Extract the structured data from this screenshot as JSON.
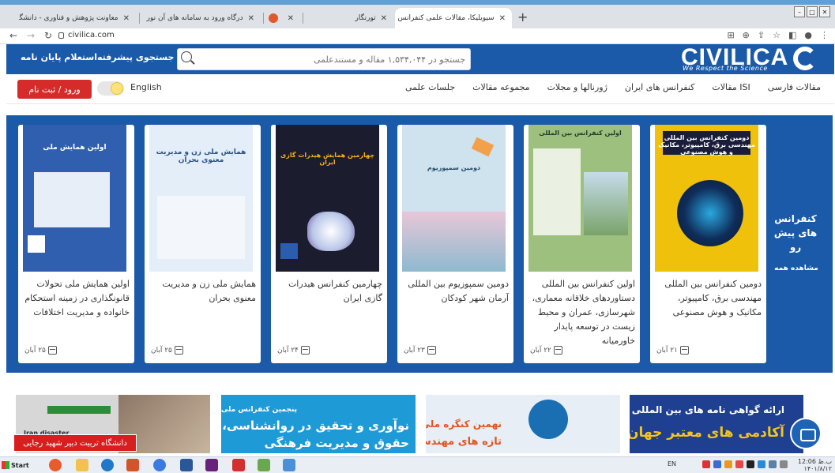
{
  "browser": {
    "tabs": [
      {
        "title": "معاونت پژوهش و فناوری - دانشگا",
        "active": false
      },
      {
        "title": "درگاه ورود به سامانه های آن نور",
        "active": false
      },
      {
        "title": "",
        "active": false
      },
      {
        "title": "تورنگار",
        "active": false
      },
      {
        "title": "سیویلیکا، مقالات علمی کنفرانس و",
        "active": true
      }
    ],
    "url": "civilica.com"
  },
  "site": {
    "logo_text": "CIVILICA",
    "tagline": "We Respect the Science",
    "search_placeholder": "جستجو در ۱,۵۳۴,۰۴۴ مقاله و مستندعلمی",
    "advanced_search": "جستجوی پیشرفته",
    "thesis_inquiry": "استعلام پایان نامه",
    "nav": [
      "مقالات فارسی",
      "مقالات ISI",
      "کنفرانس های ایران",
      "ژورنالها و مجلات",
      "مجموعه مقالات",
      "جلسات علمی"
    ],
    "login": "ورود / ثبت نام",
    "language": "English"
  },
  "conferences": {
    "heading": "کنفرانس های پیش رو",
    "see_all": "مشاهده همه",
    "cards": [
      {
        "title": "دومین کنفرانس بین المللی مهندسی برق، کامپیوتر، مکانیک و هوش مصنوعی",
        "date": "۲۱ آبان",
        "poster_color": "#f0c10a",
        "poster_text": "دومین کنفرانس بین المللی مهندسی برق، کامپیوتر، مکانیک و هوش مصنوعی"
      },
      {
        "title": "اولین کنفرانس بین المللی دستاوردهای خلاقانه معماری، شهرسازی، عمران و محیط زیست در توسعه پایدار خاورمیانه",
        "date": "۲۲ آبان",
        "poster_color": "#9dc07e",
        "poster_text": "اولین کنفرانس بین المللی"
      },
      {
        "title": "دومین سمپوزیوم بین المللی آرمان شهر کودکان",
        "date": "۲۳ آبان",
        "poster_color": "#cfe3ef",
        "poster_text": "دومین سمپوزیوم"
      },
      {
        "title": "چهارمین کنفرانس هیدرات گازی ایران",
        "date": "۲۴ آبان",
        "poster_color": "#1b1d2e",
        "poster_text": "چهارمین همایش هیدرات گازی ایران"
      },
      {
        "title": "همایش ملی زن و مدیریت معنوی بحران",
        "date": "۲۵ آبان",
        "poster_color": "#e3eef8",
        "poster_text": "همایش ملی زن و مدیریت معنوی بحران"
      },
      {
        "title": "اولین همایش ملی تحولات قانونگذاری در زمینه استحکام خانواده و مدیریت اختلافات",
        "date": "۲۵ آبان",
        "poster_color": "#2f5fae",
        "poster_text": "اولین همایش ملی"
      }
    ]
  },
  "ads": [
    {
      "text": "ارائه گواهی نامه های بین المللی",
      "text2": "آکادمی های معتبر جهان",
      "bg": "#1f3f91"
    },
    {
      "text": "نهمین کنگره ملی",
      "text2": "تازه های مهندسی برق",
      "bg": "#1a6fb3"
    },
    {
      "text": "پنجمین کنفرانس ملی",
      "text2": "نوآوری و تحقیق در روانشناسی،",
      "text3": "حقوق و مدیریت فرهنگی",
      "bg": "#1e9ad6"
    },
    {
      "text": "Iran disaster",
      "bg": "#c9c9c9"
    }
  ],
  "university_label": "دانشگاه تربیت دبیر شهید رجایی",
  "taskbar": {
    "start": "Start",
    "lang": "EN",
    "time": "12:06 ب.ظ",
    "date": "۱۴۰۱/۸/۱۲"
  }
}
